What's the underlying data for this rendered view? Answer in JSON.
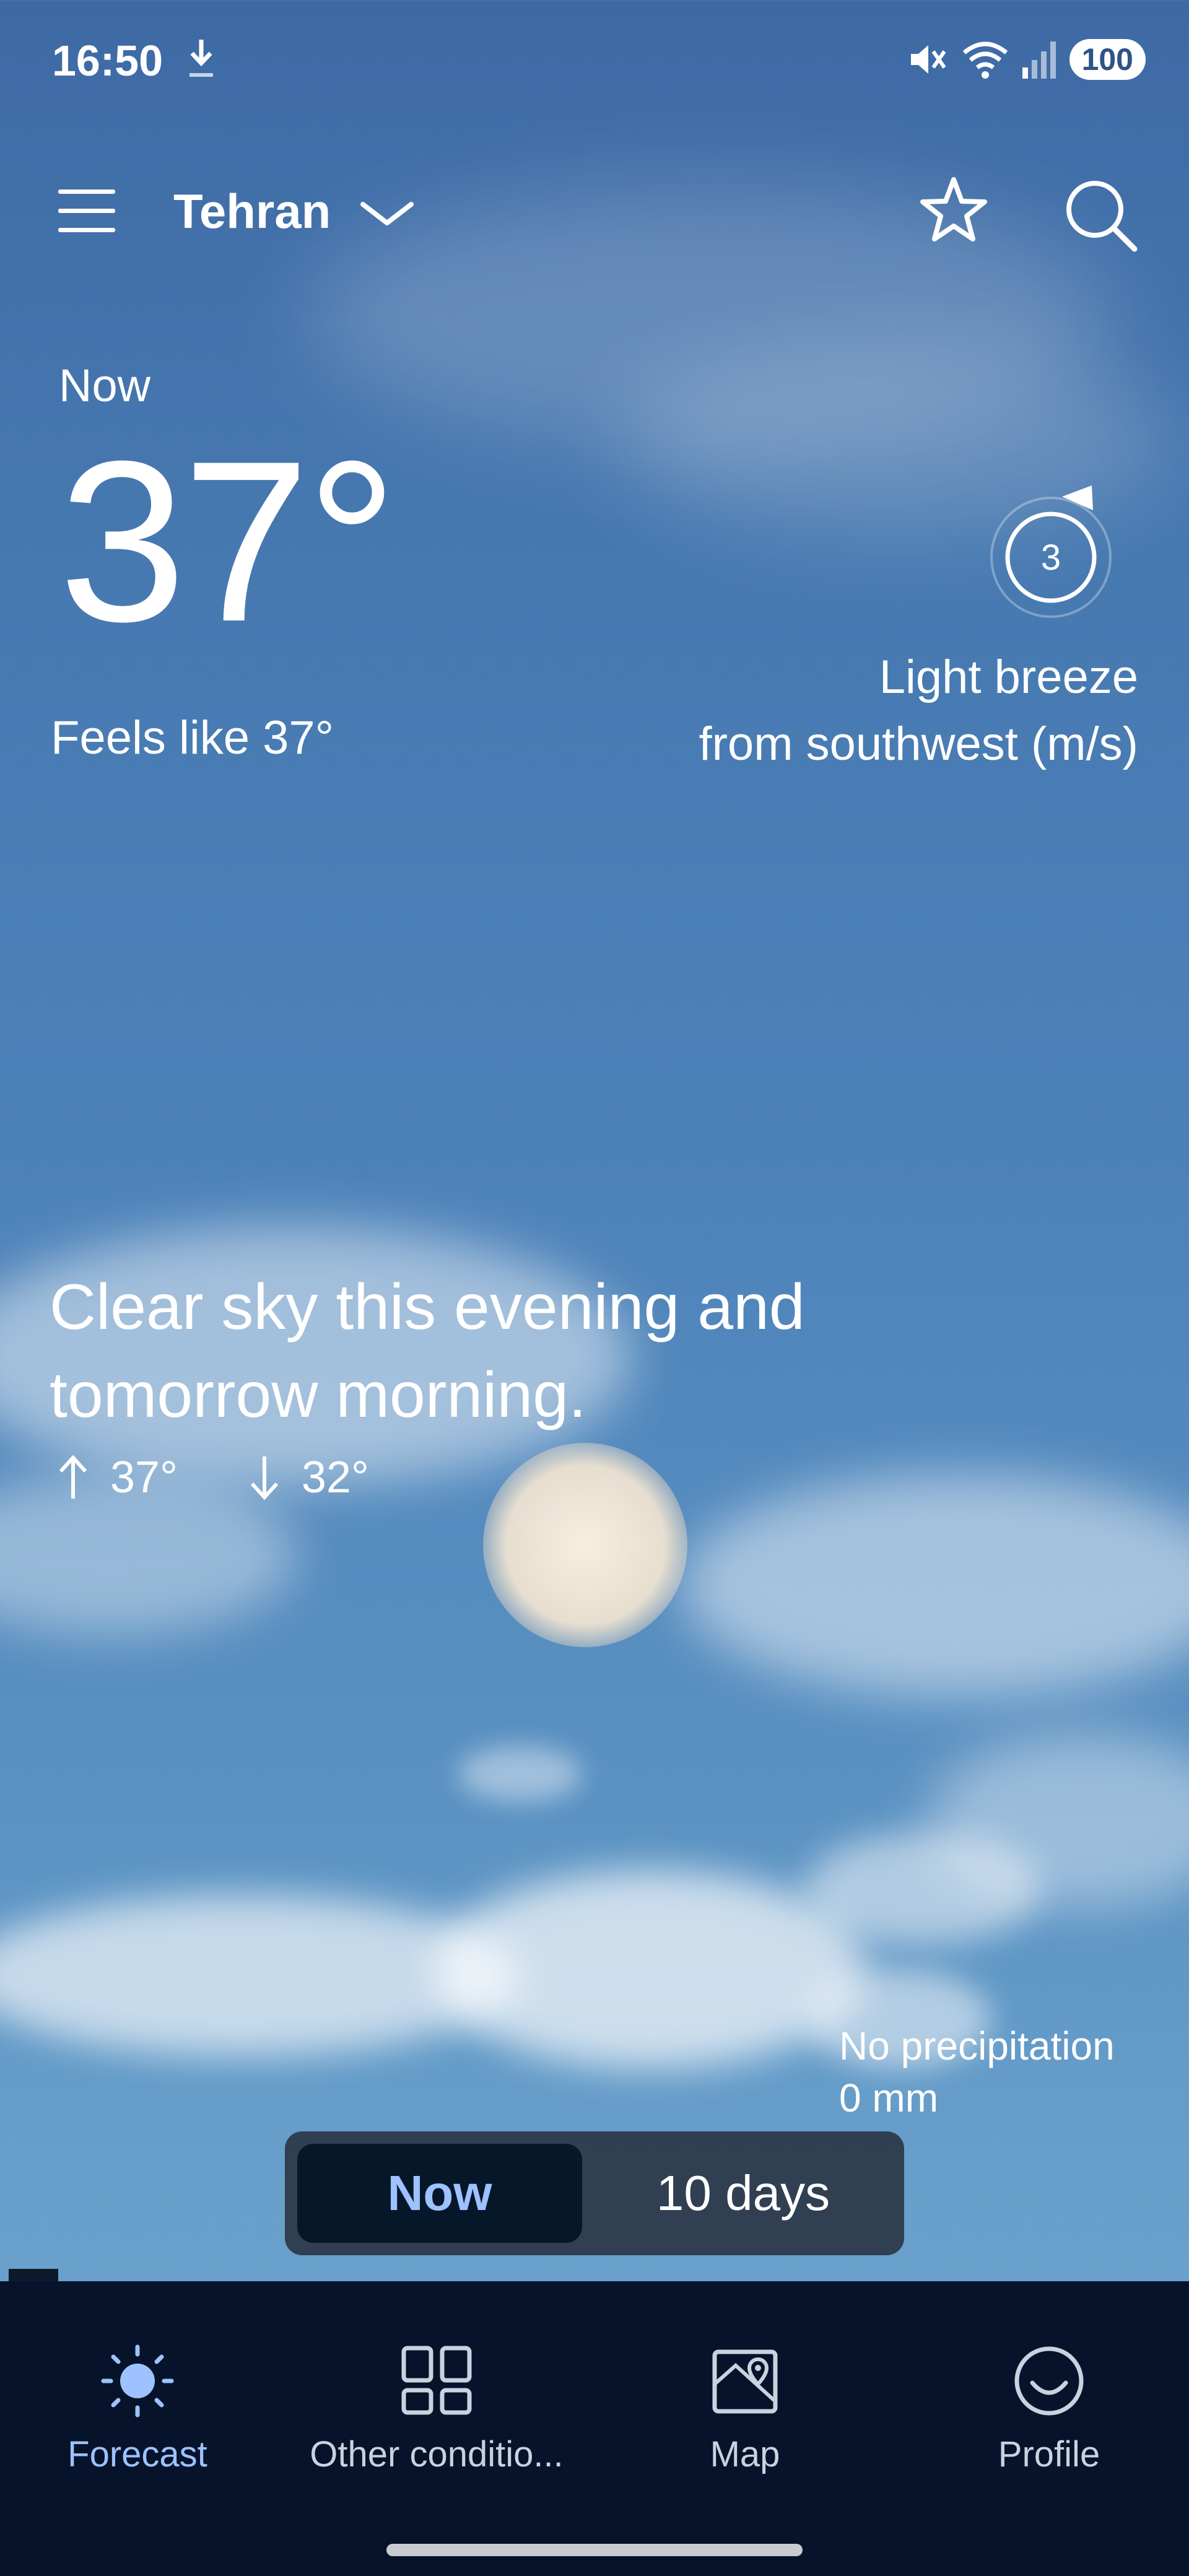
{
  "status_bar": {
    "time": "16:50",
    "battery": "100"
  },
  "header": {
    "city": "Tehran"
  },
  "current": {
    "label": "Now",
    "temperature": "37°",
    "feels_like": "Feels like 37°",
    "wind_speed": "3",
    "wind_line1": "Light breeze",
    "wind_line2": "from southwest (m/s)"
  },
  "forecast": {
    "summary": "Clear sky this evening and tomorrow morning.",
    "high": "37°",
    "low": "32°",
    "precip_line1": "No precipitation",
    "precip_line2": "0 mm"
  },
  "toggle": {
    "now": "Now",
    "ten_days": "10 days",
    "selected": "Now"
  },
  "bottom_nav": {
    "items": [
      {
        "label": "Forecast",
        "icon": "sun-icon",
        "active": true
      },
      {
        "label": "Other conditio...",
        "icon": "grid-icon",
        "active": false
      },
      {
        "label": "Map",
        "icon": "map-icon",
        "active": false
      },
      {
        "label": "Profile",
        "icon": "profile-icon",
        "active": false
      }
    ]
  },
  "colors": {
    "sky_top": "#3e6aa4",
    "sky_bottom": "#6da6cf",
    "nav_background": "#07132a",
    "accent": "#9dc2ff"
  }
}
